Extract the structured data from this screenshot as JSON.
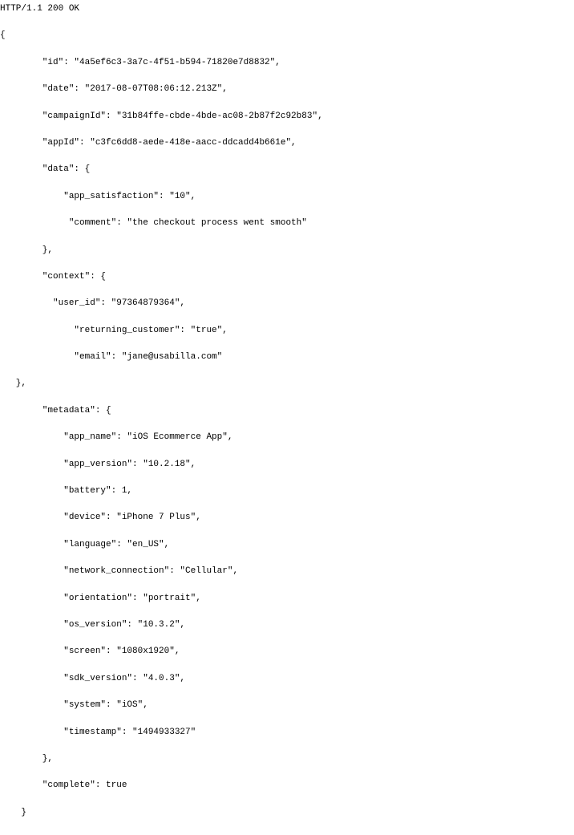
{
  "status_line": "HTTP/1.1 200 OK",
  "open_brace": "{",
  "close_brace": "    }",
  "fields": {
    "id": "        \"id\": \"4a5ef6c3-3a7c-4f51-b594-71820e7d8832\",",
    "date": "        \"date\": \"2017-08-07T08:06:12.213Z\",",
    "campaignId": "        \"campaignId\": \"31b84ffe-cbde-4bde-ac08-2b87f2c92b83\",",
    "appId": "        \"appId\": \"c3fc6dd8-aede-418e-aacc-ddcadd4b661e\",",
    "data_open": "        \"data\": {",
    "data_app_satisfaction": "            \"app_satisfaction\": \"10\",",
    "data_comment": "             \"comment\": \"the checkout process went smooth\"",
    "data_close": "        },",
    "context_open": "        \"context\": {",
    "context_user_id": "          \"user_id\": \"97364879364\",",
    "context_returning_customer": "              \"returning_customer\": \"true\",",
    "context_email": "              \"email\": \"jane@usabilla.com\"",
    "context_close": "   },",
    "metadata_open": "        \"metadata\": {",
    "metadata_app_name": "            \"app_name\": \"iOS Ecommerce App\",",
    "metadata_app_version": "            \"app_version\": \"10.2.18\",",
    "metadata_battery": "            \"battery\": 1,",
    "metadata_device": "            \"device\": \"iPhone 7 Plus\",",
    "metadata_language": "            \"language\": \"en_US\",",
    "metadata_network_connection": "            \"network_connection\": \"Cellular\",",
    "metadata_orientation": "            \"orientation\": \"portrait\",",
    "metadata_os_version": "            \"os_version\": \"10.3.2\",",
    "metadata_screen": "            \"screen\": \"1080x1920\",",
    "metadata_sdk_version": "            \"sdk_version\": \"4.0.3\",",
    "metadata_system": "            \"system\": \"iOS\",",
    "metadata_timestamp": "            \"timestamp\": \"1494933327\"",
    "metadata_close": "        },",
    "complete": "        \"complete\": true"
  },
  "indent": {
    "l0": "",
    "l1": "        ",
    "l2": "            "
  }
}
